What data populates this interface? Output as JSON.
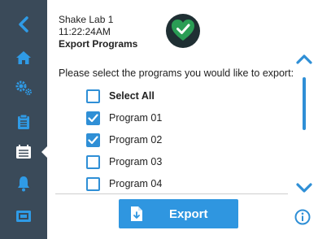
{
  "header": {
    "device_name": "Shake Lab 1",
    "time": "11:22:24AM",
    "page_title": "Export Programs"
  },
  "prompt": "Please select the programs you would like to export:",
  "select_all": {
    "label": "Select All",
    "checked": false
  },
  "programs": [
    {
      "label": "Program 01",
      "checked": true
    },
    {
      "label": "Program 02",
      "checked": true
    },
    {
      "label": "Program 03",
      "checked": false
    },
    {
      "label": "Program 04",
      "checked": false
    }
  ],
  "export_button": {
    "label": "Export"
  },
  "sidebar": {
    "items": [
      "back-icon",
      "home-icon",
      "settings-icon",
      "clipboard-icon",
      "calendar-list-icon",
      "bell-icon",
      "device-icon"
    ],
    "active": "calendar-list-icon"
  },
  "status_icon": "heart-check-icon",
  "colors": {
    "sidebar_bg": "#3a4a59",
    "accent": "#2f8fd6",
    "status_green": "#2a9d55"
  },
  "scroll_position": 0.0
}
